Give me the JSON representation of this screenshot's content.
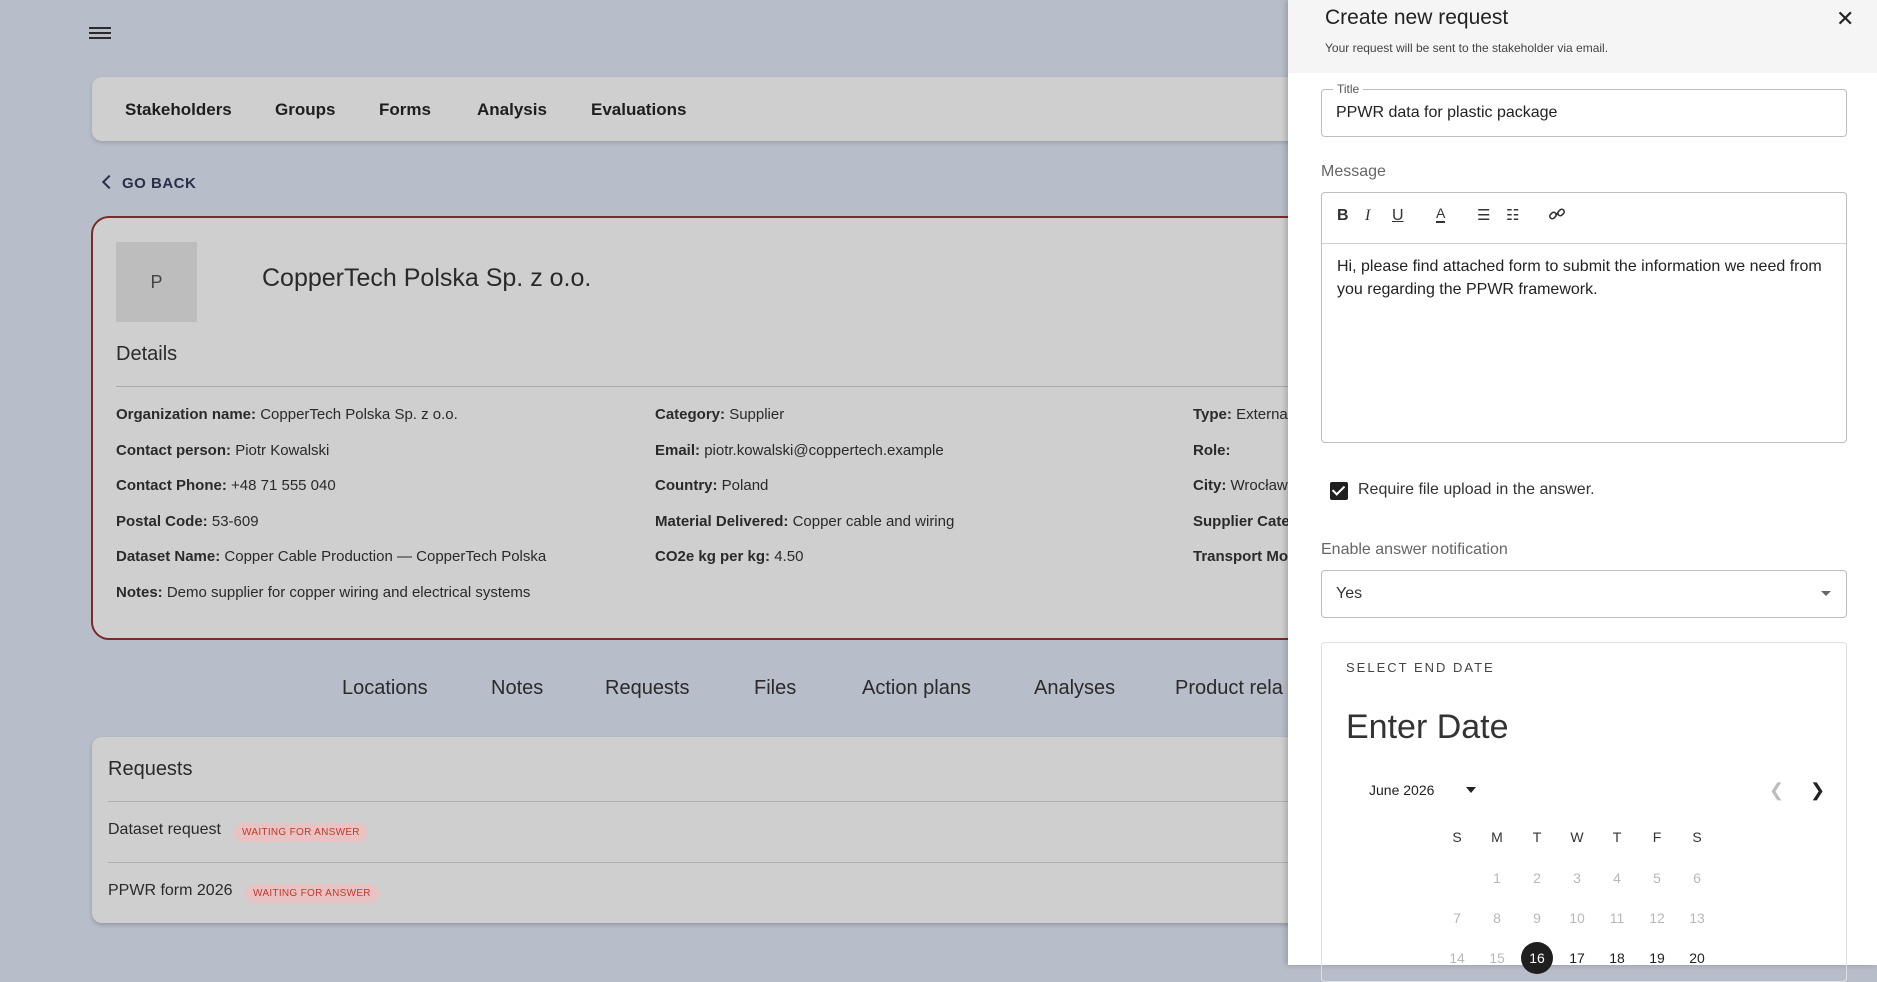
{
  "nav": {
    "items": [
      "Stakeholders",
      "Groups",
      "Forms",
      "Analysis",
      "Evaluations"
    ]
  },
  "goback": "GO BACK",
  "stakeholder": {
    "avatar_letter": "P",
    "name": "CopperTech Polska Sp. z o.o.",
    "details_heading": "Details",
    "fields": {
      "org": {
        "label": "Organization name:",
        "value": "CopperTech Polska Sp. z o.o."
      },
      "contact": {
        "label": "Contact person:",
        "value": "Piotr Kowalski"
      },
      "phone": {
        "label": "Contact Phone:",
        "value": "+48 71 555 040"
      },
      "postal": {
        "label": "Postal Code:",
        "value": "53-609"
      },
      "dataset": {
        "label": "Dataset Name:",
        "value": "Copper Cable Production — CopperTech Polska"
      },
      "notes": {
        "label": "Notes:",
        "value": "Demo supplier for copper wiring and electrical systems"
      },
      "category": {
        "label": "Category:",
        "value": "Supplier"
      },
      "email": {
        "label": "Email:",
        "value": "piotr.kowalski@coppertech.example"
      },
      "country": {
        "label": "Country:",
        "value": "Poland"
      },
      "material": {
        "label": "Material Delivered:",
        "value": "Copper cable and wiring"
      },
      "co2": {
        "label": "CO2e kg per kg:",
        "value": "4.50"
      },
      "type": {
        "label": "Type:",
        "value": "Externa"
      },
      "role": {
        "label": "Role:",
        "value": ""
      },
      "city": {
        "label": "City:",
        "value": "Wrocław"
      },
      "supplier_cat": {
        "label": "Supplier Cate",
        "value": ""
      },
      "transport": {
        "label": "Transport Mo",
        "value": ""
      }
    }
  },
  "tabs": [
    "Locations",
    "Notes",
    "Requests",
    "Files",
    "Action plans",
    "Analyses",
    "Product rela"
  ],
  "requests": {
    "heading": "Requests",
    "items": [
      {
        "name": "Dataset request",
        "status": "WAITING FOR ANSWER"
      },
      {
        "name": "PPWR form 2026",
        "status": "WAITING FOR ANSWER"
      }
    ]
  },
  "drawer": {
    "title": "Create new request",
    "subtitle": "Your request will be sent to the stakeholder via email.",
    "title_legend": "Title",
    "title_value": "PPWR data for plastic package",
    "message_label": "Message",
    "message_text": "Hi, please find attached form to submit the information we need from you regarding the PPWR framework.",
    "require_file_label": "Require file upload in the answer.",
    "require_file_checked": true,
    "notification_label": "Enable answer notification",
    "notification_value": "Yes",
    "picker": {
      "heading": "SELECT END DATE",
      "enter_date": "Enter Date",
      "month": "June 2026",
      "weekdays": [
        "S",
        "M",
        "T",
        "W",
        "T",
        "F",
        "S"
      ],
      "weeks": [
        [
          "",
          "1",
          "2",
          "3",
          "4",
          "5",
          "6"
        ],
        [
          "7",
          "8",
          "9",
          "10",
          "11",
          "12",
          "13"
        ],
        [
          "14",
          "15",
          "16",
          "17",
          "18",
          "19",
          "20"
        ]
      ],
      "selected_day": "16"
    }
  }
}
